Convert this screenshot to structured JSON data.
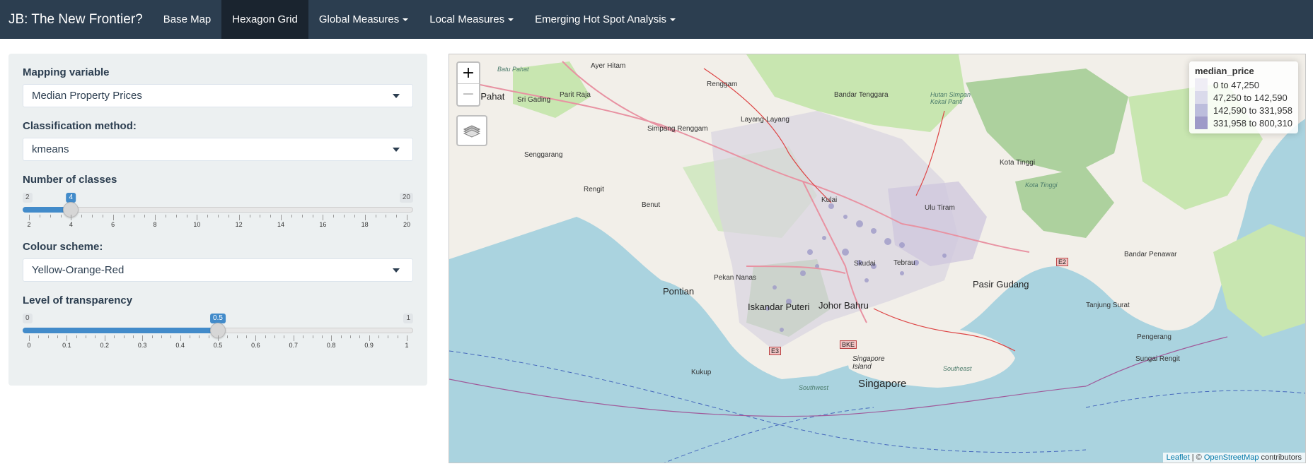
{
  "navbar": {
    "brand": "JB: The New Frontier?",
    "items": [
      {
        "label": "Base Map",
        "active": false,
        "dropdown": false
      },
      {
        "label": "Hexagon Grid",
        "active": true,
        "dropdown": false
      },
      {
        "label": "Global Measures",
        "active": false,
        "dropdown": true
      },
      {
        "label": "Local Measures",
        "active": false,
        "dropdown": true
      },
      {
        "label": "Emerging Hot Spot Analysis",
        "active": false,
        "dropdown": true
      }
    ]
  },
  "sidebar": {
    "mapping_variable": {
      "label": "Mapping variable",
      "value": "Median Property Prices"
    },
    "classification": {
      "label": "Classification method:",
      "value": "kmeans"
    },
    "num_classes": {
      "label": "Number of classes",
      "min": 2,
      "max": 20,
      "value": 4,
      "ticks": [
        "2",
        "4",
        "6",
        "8",
        "10",
        "12",
        "14",
        "16",
        "18",
        "20"
      ]
    },
    "colour_scheme": {
      "label": "Colour scheme:",
      "value": "Yellow-Orange-Red"
    },
    "transparency": {
      "label": "Level of transparency",
      "min": 0,
      "max": 1,
      "value": 0.5,
      "ticks": [
        "0",
        "0.1",
        "0.2",
        "0.3",
        "0.4",
        "0.5",
        "0.6",
        "0.7",
        "0.8",
        "0.9",
        "1"
      ]
    }
  },
  "map": {
    "zoom_in": "+",
    "zoom_out": "−",
    "legend": {
      "title": "median_price",
      "items": [
        {
          "label": "0 to 47,250",
          "color": "#efedf5"
        },
        {
          "label": "47,250 to 142,590",
          "color": "#dadaeb"
        },
        {
          "label": "142,590 to 331,958",
          "color": "#bcbddc"
        },
        {
          "label": "331,958 to 800,310",
          "color": "#9e9ac8"
        }
      ]
    },
    "attribution": {
      "leaflet": "Leaflet",
      "sep": " | © ",
      "osm": "OpenStreetMap",
      "suffix": " contributors"
    },
    "labels": {
      "batu_pahat": "Batu Pahat",
      "ayer_hitam": "Ayer Hitam",
      "renggam": "Renggam",
      "bandar_tenggara": "Bandar Tenggara",
      "hutan_simpan": "Hutan Simpan Kekal Panti",
      "sri_gading": "Sri Gading",
      "parit_raja": "Parit Raja",
      "simpang_renggam": "Simpang Renggam",
      "layang_layang": "Layang-Layang",
      "senggarang": "Senggarang",
      "kota_tinggi": "Kota Tinggi",
      "kota_tinggi_river": "Kota Tinggi",
      "rengit": "Rengit",
      "benut": "Benut",
      "kulai": "Kulai",
      "ulu_tiram": "Ulu Tiram",
      "e2": "E2",
      "bandar_penawar": "Bandar Penawar",
      "pekan_nanas": "Pekan Nanas",
      "skudai": "Skudai",
      "tebrau": "Tebrau",
      "pontian": "Pontian",
      "pasir_gudang": "Pasir Gudang",
      "tanjung_surat": "Tanjung Surat",
      "iskandar_puteri": "Iskandar Puteri",
      "johor_bahru": "Johor Bahru",
      "bke": "BKE",
      "pengerang": "Pengerang",
      "singapore_island": "Singapore Island",
      "sungai_rengit": "Sungai Rengit",
      "kukup": "Kukup",
      "singapore": "Singapore",
      "southeast": "Southeast",
      "southwest": "Southwest",
      "e3": "E3"
    }
  }
}
